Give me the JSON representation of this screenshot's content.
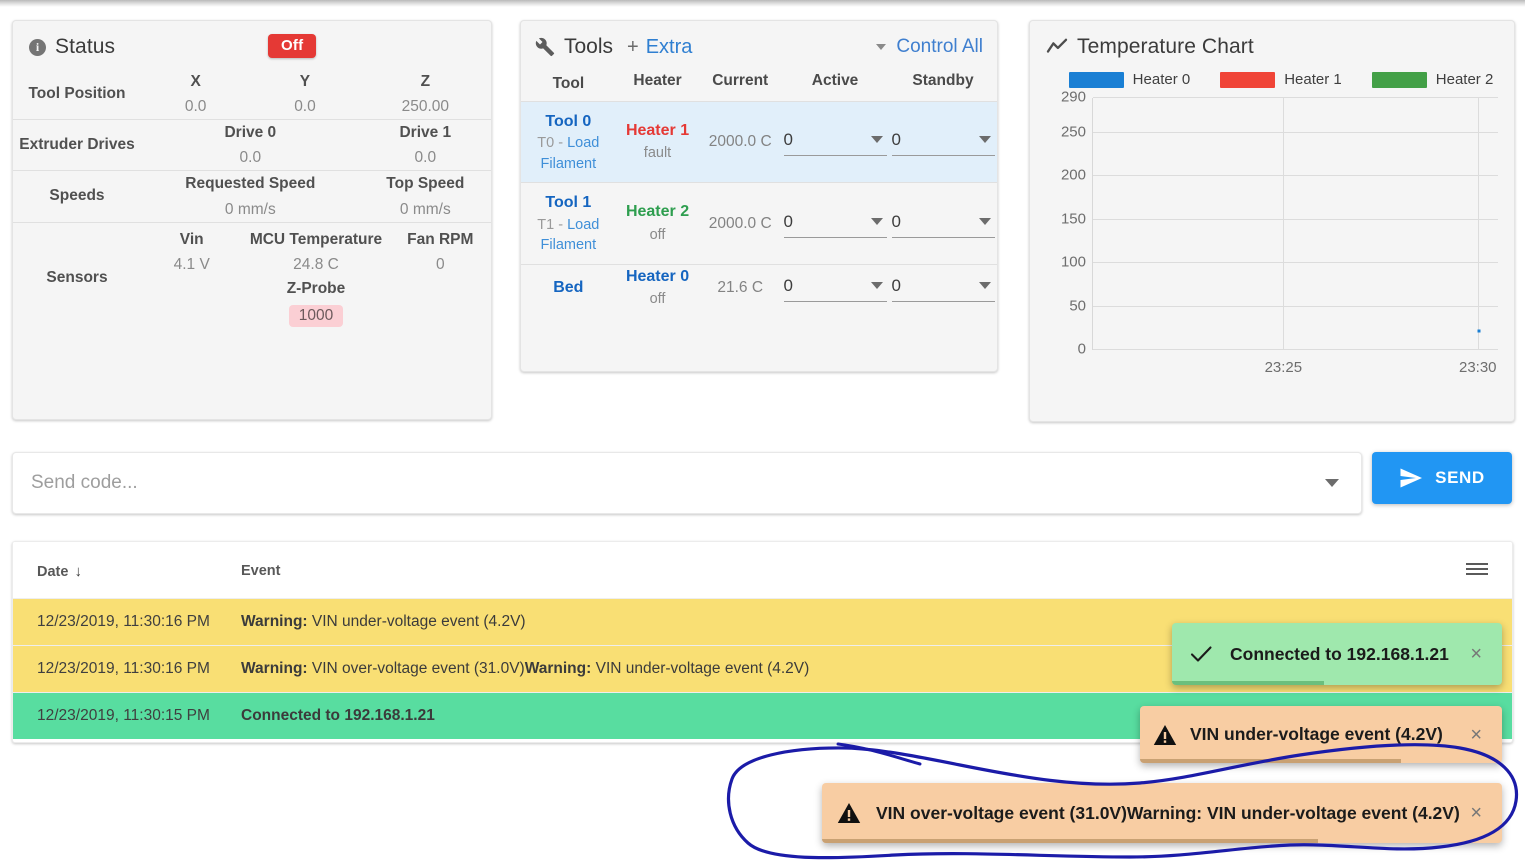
{
  "status": {
    "title": "Status",
    "icon": "info-icon",
    "badge": "Off",
    "badge_color": "#e53935",
    "rows": [
      {
        "label": "Tool Position",
        "cells": [
          {
            "head": "X",
            "value": "0.0"
          },
          {
            "head": "Y",
            "value": "0.0"
          },
          {
            "head": "Z",
            "value": "250.00"
          }
        ]
      },
      {
        "label": "Extruder Drives",
        "cells": [
          {
            "head": "Drive 0",
            "value": "0.0"
          },
          {
            "head": "Drive 1",
            "value": "0.0"
          }
        ]
      },
      {
        "label": "Speeds",
        "cells": [
          {
            "head": "Requested Speed",
            "value": "0 mm/s"
          },
          {
            "head": "Top Speed",
            "value": "0 mm/s"
          }
        ]
      },
      {
        "label": "Sensors",
        "cells": [
          {
            "head": "Vin",
            "value": "4.1 V"
          },
          {
            "head": "MCU Temperature",
            "value": "24.8 C"
          },
          {
            "head": "Fan RPM",
            "value": "0"
          }
        ],
        "extra": {
          "head": "Z-Probe",
          "value": "1000"
        }
      }
    ]
  },
  "tools": {
    "title": "Tools",
    "icon": "wrench-icon",
    "plus": "+",
    "extra_link": "Extra",
    "control_all": "Control All",
    "columns": [
      "Tool",
      "Heater",
      "Current",
      "Active",
      "Standby"
    ],
    "rows": [
      {
        "tool": "Tool 0",
        "tool_sub_prefix": "T0 - ",
        "tool_sub_link": "Load Filament",
        "heater": "Heater 1",
        "heater_color": "#e53935",
        "heater_state": "fault",
        "current": "2000.0 C",
        "active": "0",
        "standby": "0",
        "highlighted": true
      },
      {
        "tool": "Tool 1",
        "tool_sub_prefix": "T1 - ",
        "tool_sub_link": "Load Filament",
        "heater": "Heater 2",
        "heater_color": "#2e9e4f",
        "heater_state": "off",
        "current": "2000.0 C",
        "active": "0",
        "standby": "0",
        "highlighted": false
      },
      {
        "tool": "Bed",
        "tool_sub_prefix": "",
        "tool_sub_link": "",
        "heater": "Heater 0",
        "heater_color": "#1565c0",
        "heater_state": "off",
        "current": "21.6 C",
        "active": "0",
        "standby": "0",
        "highlighted": false
      }
    ]
  },
  "chart": {
    "title": "Temperature Chart",
    "icon": "line-chart-icon"
  },
  "chart_data": {
    "type": "line",
    "title": "Temperature Chart",
    "xlabel": "",
    "ylabel": "",
    "grid": true,
    "legend_position": "top",
    "ylim": [
      0,
      290
    ],
    "yticks": [
      0,
      50,
      100,
      150,
      200,
      250,
      290
    ],
    "xticks": [
      "23:25",
      "23:30"
    ],
    "xtick_positions": [
      0.47,
      0.95
    ],
    "series": [
      {
        "name": "Heater 0",
        "color": "#1a7fd4",
        "points": [
          {
            "x": 0.952,
            "y": 21.6
          }
        ]
      },
      {
        "name": "Heater 1",
        "color": "#f04437",
        "points": []
      },
      {
        "name": "Heater 2",
        "color": "#43a047",
        "points": []
      }
    ]
  },
  "sendbar": {
    "placeholder": "Send code...",
    "value": "",
    "send_label": "SEND",
    "send_icon": "send-icon",
    "dropdown_icon": "chevron-down-icon",
    "accent": "#2196f3"
  },
  "log": {
    "columns": {
      "date": "Date",
      "event": "Event",
      "sort_icon": "↓",
      "menu_icon": "hamburger-icon"
    },
    "rows": [
      {
        "date": "12/23/2019, 11:30:16 PM",
        "prefix": "Warning:",
        "text": " VIN under-voltage event (4.2V)",
        "kind": "warn"
      },
      {
        "date": "12/23/2019, 11:30:16 PM",
        "prefix": "Warning:",
        "text": " VIN over-voltage event (31.0V)",
        "prefix2": "Warning:",
        "text2": " VIN under-voltage event (4.2V)",
        "kind": "warn"
      },
      {
        "date": "12/23/2019, 11:30:15 PM",
        "prefix": "Connected to 192.168.1.21",
        "text": "",
        "kind": "ok"
      }
    ]
  },
  "toasts": [
    {
      "id": "connected",
      "icon": "check-icon",
      "message": "Connected to 192.168.1.21",
      "close": "×",
      "bg": "#9fe8ad",
      "progress": "#6bbf7d",
      "progress_pct": 46
    },
    {
      "id": "under-voltage",
      "icon": "warning-triangle-icon",
      "message": "VIN under-voltage event (4.2V)",
      "close": "×",
      "bg": "#f8cda3",
      "progress": "#c9a173",
      "progress_pct": 72
    },
    {
      "id": "over-voltage",
      "icon": "warning-triangle-icon",
      "message": "VIN over-voltage event (31.0V)Warning: VIN under-voltage event (4.2V)",
      "close": "×",
      "bg": "#f8cda3",
      "progress": "#c9a173",
      "progress_pct": 73
    }
  ],
  "annotation": {
    "shape": "hand-drawn-ellipse",
    "color": "#1b1ba8"
  }
}
